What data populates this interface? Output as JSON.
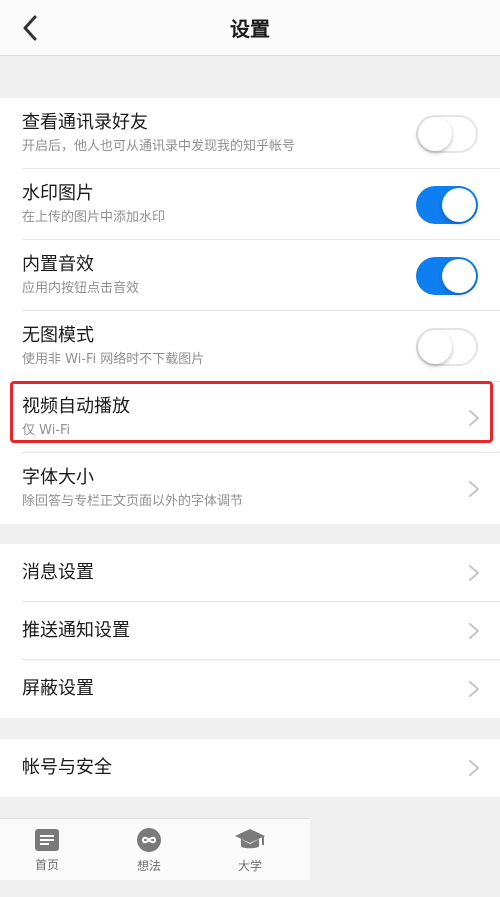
{
  "navbar": {
    "title": "设置",
    "back_icon": "chevron-left-icon"
  },
  "privacy_group": {
    "contacts": {
      "title": "查看通讯录好友",
      "subtitle": "开启后，他人也可从通讯录中发现我的知乎帐号",
      "enabled": false
    },
    "watermark": {
      "title": "水印图片",
      "subtitle": "在上传的图片中添加水印",
      "enabled": true
    },
    "sound": {
      "title": "内置音效",
      "subtitle": "应用内按钮点击音效",
      "enabled": true
    },
    "no_image": {
      "title": "无图模式",
      "subtitle": "使用非 Wi-Fi 网络时不下载图片",
      "enabled": false
    },
    "autoplay": {
      "title": "视频自动播放",
      "subtitle": "仅 Wi-Fi"
    },
    "font_size": {
      "title": "字体大小",
      "subtitle": "除回答与专栏正文页面以外的字体调节"
    }
  },
  "notify_group": {
    "messages": {
      "title": "消息设置"
    },
    "push": {
      "title": "推送通知设置"
    },
    "block": {
      "title": "屏蔽设置"
    }
  },
  "account_group": {
    "account": {
      "title": "帐号与安全"
    }
  },
  "tabbar": {
    "tabs": [
      {
        "label": "首页",
        "icon": "document-icon"
      },
      {
        "label": "想法",
        "icon": "infinity-icon"
      },
      {
        "label": "大学",
        "icon": "graduation-cap-icon"
      }
    ]
  },
  "colors": {
    "accent": "#0f7ef0",
    "highlight": "#e6262b"
  }
}
